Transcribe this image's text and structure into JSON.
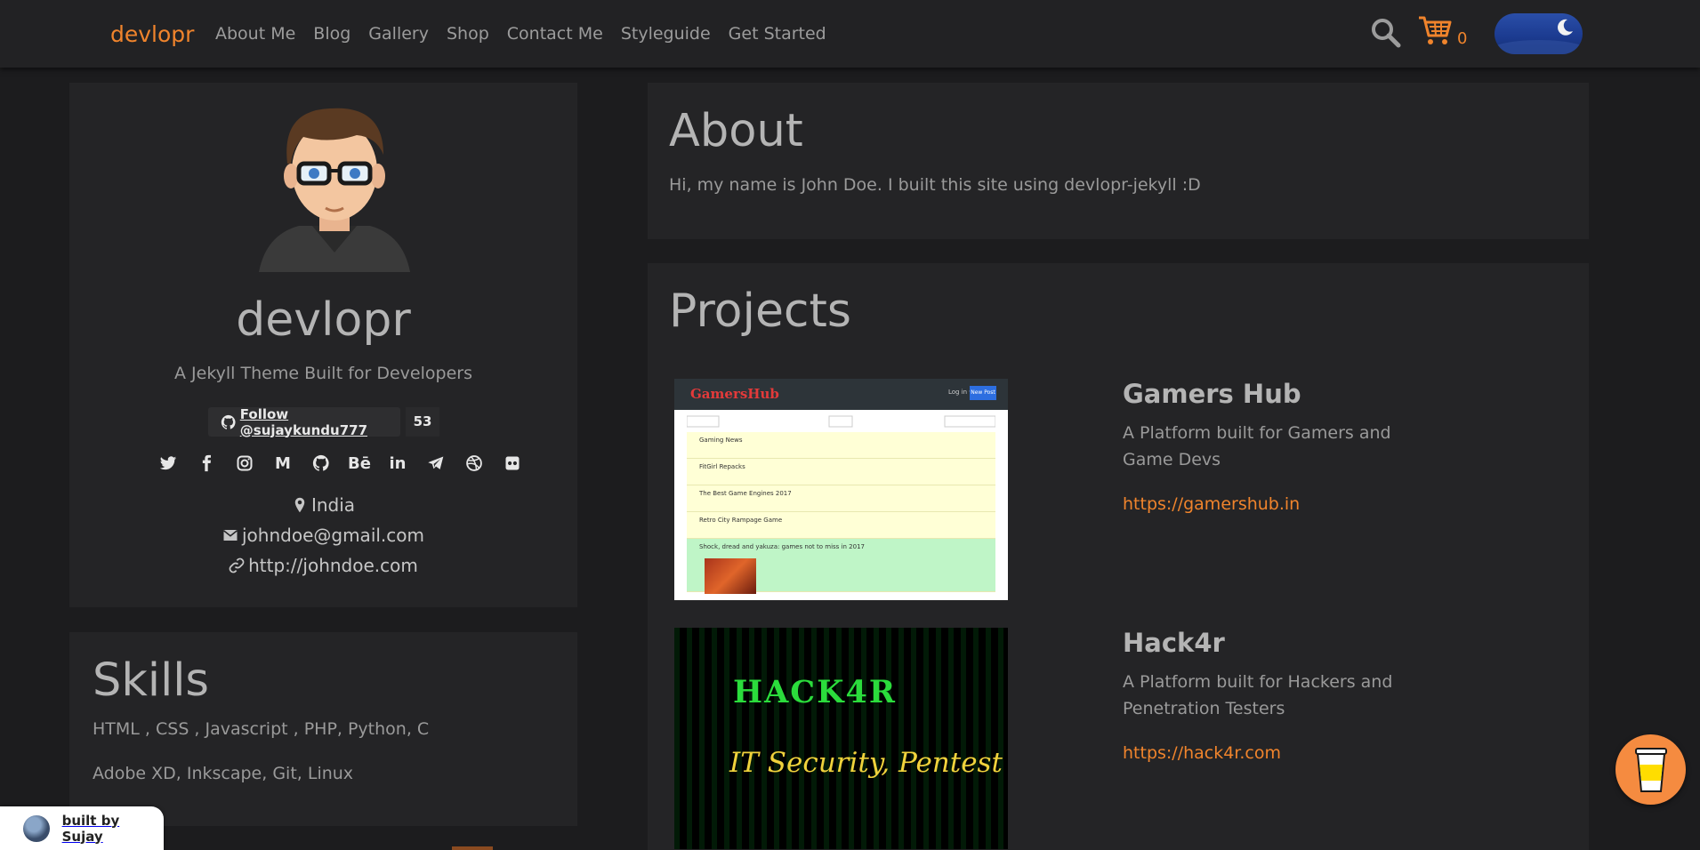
{
  "navbar": {
    "brand": "devlopr",
    "links": [
      "About Me",
      "Blog",
      "Gallery",
      "Shop",
      "Contact Me",
      "Styleguide",
      "Get Started"
    ],
    "cart_count": "0"
  },
  "profile": {
    "name": "devlopr",
    "tagline": "A Jekyll Theme Built for Developers",
    "github_follow": "Follow @sujaykundu777",
    "github_count": "53",
    "socials": [
      "twitter-icon",
      "facebook-icon",
      "instagram-icon",
      "medium-icon",
      "github-icon",
      "behance-icon",
      "linkedin-icon",
      "telegram-icon",
      "dribbble-icon",
      "flickr-icon"
    ],
    "location": "India",
    "email": "johndoe@gmail.com",
    "website": "http://johndoe.com"
  },
  "skills": {
    "title": "Skills",
    "lines": [
      "HTML , CSS , Javascript , PHP, Python, C",
      "Adobe XD, Inkscape, Git, Linux"
    ]
  },
  "about": {
    "title": "About",
    "text": "Hi, my name is John Doe. I built this site using devlopr-jekyll :D"
  },
  "projects": {
    "title": "Projects",
    "items": [
      {
        "name": "Gamers Hub",
        "description": "A Platform built for Gamers and Game Devs",
        "link": "https://gamershub.in"
      },
      {
        "name": "Hack4r",
        "description": "A Platform built for Hackers and Penetration Testers",
        "link": "https://hack4r.com"
      }
    ]
  },
  "screenshots": {
    "gamershub": {
      "logo": "GamersHub",
      "login": "Log in ▾",
      "new_post": "New Post",
      "posts": [
        "Gaming News",
        "FitGirl Repacks",
        "The Best Game Engines 2017",
        "Retro City Rampage Game",
        "Shock, dread and yakuza: games not to miss in 2017"
      ]
    },
    "hack4r": {
      "logo": "HACK4R",
      "subtitle": "IT Security, Pentest"
    }
  },
  "footer": {
    "built_by": "built by Sujay"
  },
  "colors": {
    "accent": "#f0842c",
    "background": "#1c1c1e",
    "card": "#242426"
  }
}
